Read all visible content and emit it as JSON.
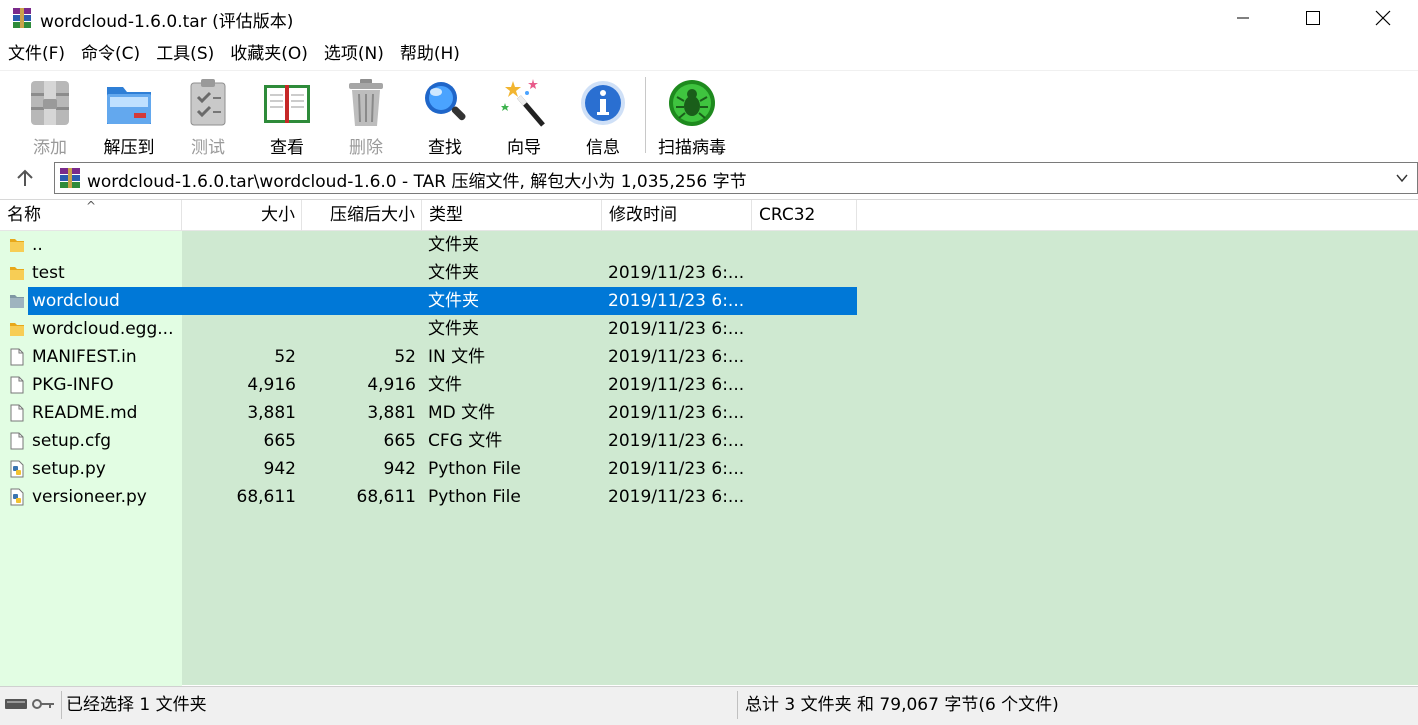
{
  "window": {
    "title": "wordcloud-1.6.0.tar (评估版本)"
  },
  "menu": [
    {
      "label": "文件(F)"
    },
    {
      "label": "命令(C)"
    },
    {
      "label": "工具(S)"
    },
    {
      "label": "收藏夹(O)"
    },
    {
      "label": "选项(N)"
    },
    {
      "label": "帮助(H)"
    }
  ],
  "toolbar": [
    {
      "label": "添加",
      "icon": "add-archive-icon",
      "enabled": false
    },
    {
      "label": "解压到",
      "icon": "extract-to-icon",
      "enabled": true
    },
    {
      "label": "测试",
      "icon": "test-icon",
      "enabled": false
    },
    {
      "label": "查看",
      "icon": "view-book-icon",
      "enabled": true
    },
    {
      "label": "删除",
      "icon": "trash-icon",
      "enabled": false
    },
    {
      "label": "查找",
      "icon": "magnifier-icon",
      "enabled": true
    },
    {
      "label": "向导",
      "icon": "wizard-wand-icon",
      "enabled": true
    },
    {
      "label": "信息",
      "icon": "info-icon",
      "enabled": true
    },
    {
      "label": "扫描病毒",
      "icon": "virus-scan-icon",
      "enabled": true
    }
  ],
  "address": {
    "path": "wordcloud-1.6.0.tar\\wordcloud-1.6.0 - TAR 压缩文件, 解包大小为 1,035,256 字节"
  },
  "columns": {
    "name": "名称",
    "size": "大小",
    "packed": "压缩后大小",
    "type": "类型",
    "modified": "修改时间",
    "crc": "CRC32"
  },
  "files": [
    {
      "name": "..",
      "size": "",
      "packed": "",
      "type": "文件夹",
      "modified": "",
      "icon": "folder-icon",
      "selected": false
    },
    {
      "name": "test",
      "size": "",
      "packed": "",
      "type": "文件夹",
      "modified": "2019/11/23 6:...",
      "icon": "folder-icon",
      "selected": false
    },
    {
      "name": "wordcloud",
      "size": "",
      "packed": "",
      "type": "文件夹",
      "modified": "2019/11/23 6:...",
      "icon": "folder-icon",
      "selected": true
    },
    {
      "name": "wordcloud.egg...",
      "size": "",
      "packed": "",
      "type": "文件夹",
      "modified": "2019/11/23 6:...",
      "icon": "folder-icon",
      "selected": false
    },
    {
      "name": "MANIFEST.in",
      "size": "52",
      "packed": "52",
      "type": "IN 文件",
      "modified": "2019/11/23 6:...",
      "icon": "file-icon",
      "selected": false
    },
    {
      "name": "PKG-INFO",
      "size": "4,916",
      "packed": "4,916",
      "type": "文件",
      "modified": "2019/11/23 6:...",
      "icon": "file-icon",
      "selected": false
    },
    {
      "name": "README.md",
      "size": "3,881",
      "packed": "3,881",
      "type": "MD 文件",
      "modified": "2019/11/23 6:...",
      "icon": "file-icon",
      "selected": false
    },
    {
      "name": "setup.cfg",
      "size": "665",
      "packed": "665",
      "type": "CFG 文件",
      "modified": "2019/11/23 6:...",
      "icon": "file-icon",
      "selected": false
    },
    {
      "name": "setup.py",
      "size": "942",
      "packed": "942",
      "type": "Python File",
      "modified": "2019/11/23 6:...",
      "icon": "python-file-icon",
      "selected": false
    },
    {
      "name": "versioneer.py",
      "size": "68,611",
      "packed": "68,611",
      "type": "Python File",
      "modified": "2019/11/23 6:...",
      "icon": "python-file-icon",
      "selected": false
    }
  ],
  "status": {
    "left": "已经选择 1 文件夹",
    "right": "总计 3 文件夹 和 79,067 字节(6 个文件)"
  },
  "colors": {
    "selection": "#0078d7",
    "list_bg": "#cfe9d1",
    "name_col_bg": "#e2fde3"
  }
}
